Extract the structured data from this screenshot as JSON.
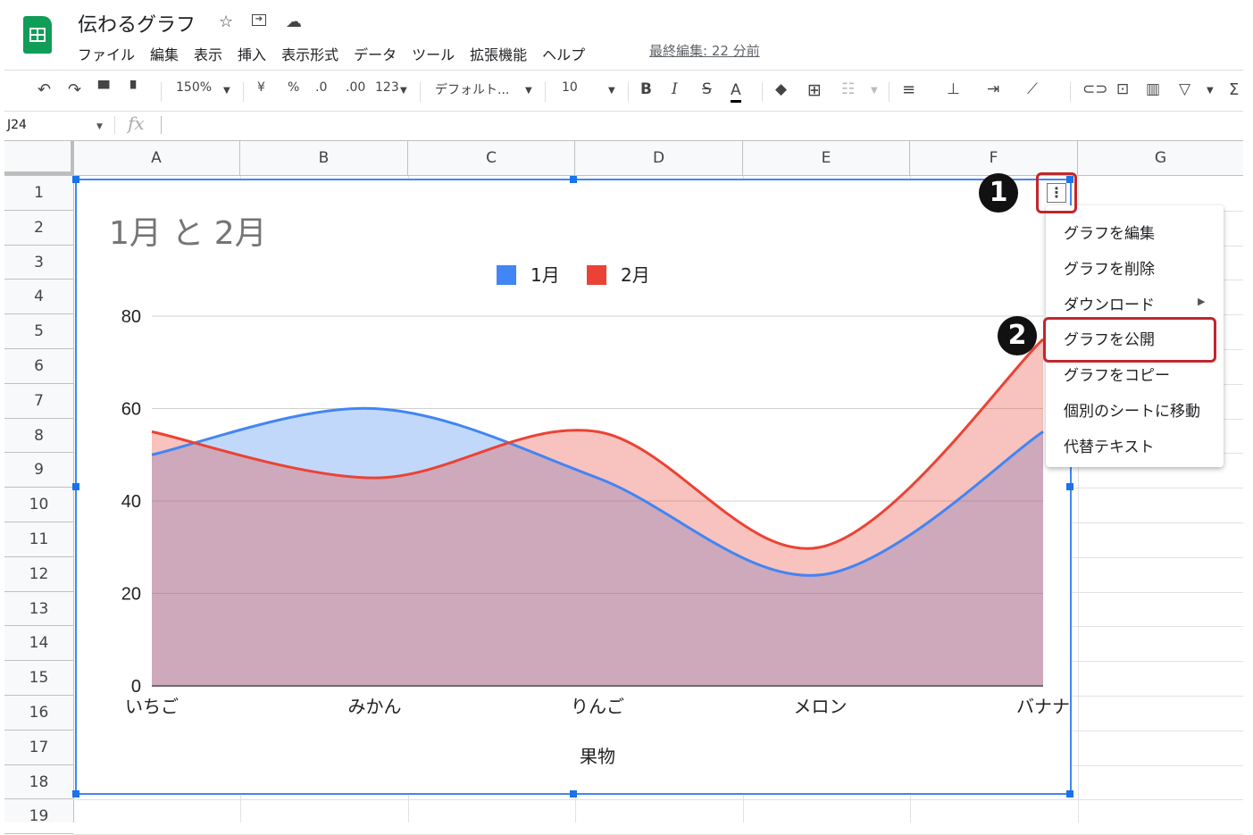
{
  "app": {
    "title": "伝わるグラフ",
    "title_icons": [
      "star-icon",
      "move-to-folder-icon",
      "cloud-status-icon"
    ],
    "menu": [
      "ファイル",
      "編集",
      "表示",
      "挿入",
      "表示形式",
      "データ",
      "ツール",
      "拡張機能",
      "ヘルプ"
    ],
    "last_edit": "最終編集: 22 分前"
  },
  "toolbar": {
    "zoom": "150%",
    "currency": "¥",
    "percent": "%",
    "decrease_decimal": ".0",
    "increase_decimal": ".00",
    "number_format": "123",
    "font": "デフォルト...",
    "font_size": "10",
    "bold": "B",
    "italic": "I",
    "strikethrough": "S",
    "text_color": "A"
  },
  "formula_bar": {
    "cell_ref": "J24",
    "fx": "fx"
  },
  "grid": {
    "columns": [
      "A",
      "B",
      "C",
      "D",
      "E",
      "F",
      "G"
    ],
    "rows": [
      "1",
      "2",
      "3",
      "4",
      "5",
      "6",
      "7",
      "8",
      "9",
      "10",
      "11",
      "12",
      "13",
      "14",
      "15",
      "16",
      "17",
      "18",
      "19"
    ]
  },
  "chart_data": {
    "type": "area",
    "title": "1月 と 2月",
    "categories": [
      "いちご",
      "みかん",
      "りんご",
      "メロン",
      "バナナ"
    ],
    "series": [
      {
        "name": "1月",
        "values": [
          50,
          60,
          45,
          24,
          55
        ],
        "color": "#4285f4"
      },
      {
        "name": "2月",
        "values": [
          55,
          45,
          55,
          30,
          75
        ],
        "color": "#ea4335"
      }
    ],
    "xlabel": "果物",
    "ylabel": "",
    "ylim": [
      0,
      80
    ],
    "yticks": [
      "0",
      "20",
      "40",
      "60",
      "80"
    ],
    "grid": true,
    "legend": "top",
    "smooth": true
  },
  "chart_menu": {
    "items": [
      "グラフを編集",
      "グラフを削除",
      "ダウンロード",
      "グラフを公開",
      "グラフをコピー",
      "個別のシートに移動",
      "代替テキスト"
    ],
    "highlighted": "グラフを公開"
  },
  "annotations": {
    "badge1": "1",
    "badge2": "2",
    "highlight_color": "#c0272d"
  }
}
